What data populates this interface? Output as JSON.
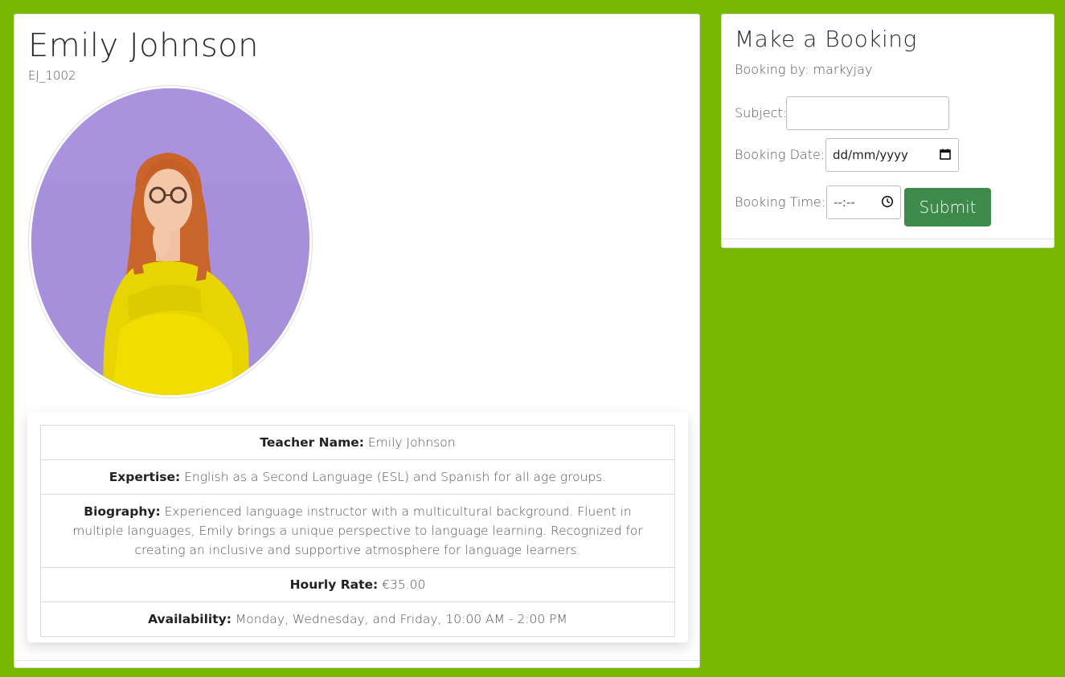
{
  "profile": {
    "name": "Emily Johnson",
    "code": "EJ_1002",
    "details": [
      {
        "label": "Teacher Name:",
        "value": "Emily Johnson"
      },
      {
        "label": "Expertise:",
        "value": "English as a Second Language (ESL) and Spanish for all age groups."
      },
      {
        "label": "Biography:",
        "value": "Experienced language instructor with a multicultural background. Fluent in multiple languages, Emily brings a unique perspective to language learning. Recognized for creating an inclusive and supportive atmosphere for language learners."
      },
      {
        "label": "Hourly Rate:",
        "value": "€35.00"
      },
      {
        "label": "Availability:",
        "value": "Monday, Wednesday, and Friday, 10:00 AM - 2:00 PM"
      }
    ]
  },
  "booking": {
    "title": "Make a Booking",
    "booking_by": "Booking by: markyjay",
    "subject_label": "Subject:",
    "subject_value": "",
    "date_label": "Booking Date:",
    "date_placeholder": "dd/mm/yyyy",
    "time_label": "Booking Time:",
    "time_placeholder": "--:--",
    "submit_label": "Submit"
  },
  "colors": {
    "background": "#77b900",
    "submit_button": "#3e8a4a",
    "avatar_background": "#a78ddc"
  }
}
